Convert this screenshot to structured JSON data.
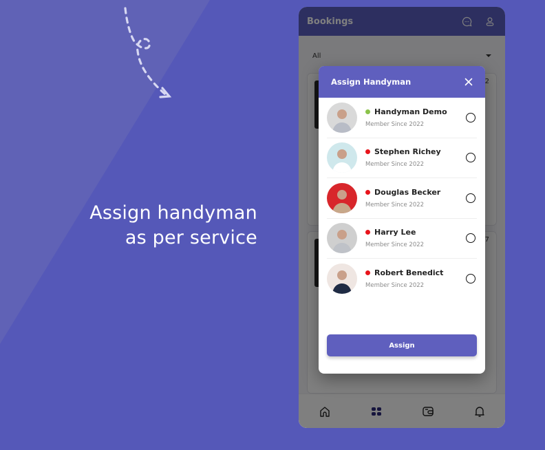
{
  "promo": {
    "tagline_line1": "Assign handyman",
    "tagline_line2": "as per service"
  },
  "app": {
    "title": "Bookings",
    "header_icons": [
      "chat-icon",
      "user-icon"
    ],
    "filter": {
      "selected": "All"
    },
    "background_cards": [
      {
        "number": "2"
      },
      {
        "number": "7"
      }
    ],
    "bottom_nav": [
      {
        "icon": "home-icon",
        "active": false
      },
      {
        "icon": "bookings-icon",
        "active": true
      },
      {
        "icon": "wallet-icon",
        "active": false
      },
      {
        "icon": "bell-icon",
        "active": false
      }
    ]
  },
  "modal": {
    "title": "Assign Handyman",
    "close_icon": "close-icon",
    "handymen": [
      {
        "name": "Handyman Demo",
        "since": "Member Since 2022",
        "status": "online",
        "status_color": "#8bc34a",
        "avatar_bg": "#d9d9d9",
        "selected": false
      },
      {
        "name": "Stephen Richey",
        "since": "Member Since 2022",
        "status": "offline",
        "status_color": "#e8141b",
        "avatar_bg": "#cfe8ec",
        "selected": false
      },
      {
        "name": "Douglas Becker",
        "since": "Member Since 2022",
        "status": "offline",
        "status_color": "#e8141b",
        "avatar_bg": "#d8262b",
        "selected": false
      },
      {
        "name": "Harry Lee",
        "since": "Member Since 2022",
        "status": "offline",
        "status_color": "#e8141b",
        "avatar_bg": "#cfcfcf",
        "selected": false
      },
      {
        "name": "Robert Benedict",
        "since": "Member Since 2022",
        "status": "offline",
        "status_color": "#e8141b",
        "avatar_bg": "#efe6e2",
        "selected": false
      }
    ],
    "assign_label": "Assign"
  },
  "colors": {
    "background": "#5558b8",
    "accent": "#5f5fbe",
    "online": "#8bc34a",
    "offline": "#e8141b"
  }
}
